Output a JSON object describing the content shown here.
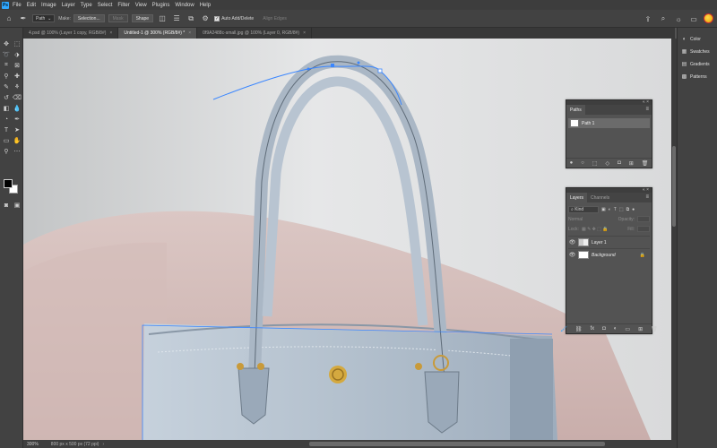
{
  "menu": [
    "File",
    "Edit",
    "Image",
    "Layer",
    "Type",
    "Select",
    "Filter",
    "View",
    "Plugins",
    "Window",
    "Help"
  ],
  "app_logo": "Ps",
  "options": {
    "tool_mode": "Path",
    "make_label": "Make:",
    "selection_btn": "Selection...",
    "mask_btn": "Mask",
    "shape_btn": "Shape",
    "auto_add_delete": "Auto Add/Delete",
    "align_edges": "Align Edges"
  },
  "tabs": [
    {
      "label": "4.psd @ 100% (Layer 1 copy, RGB/8#)",
      "close": "×"
    },
    {
      "label": "Untitled-1 @ 300% (RGB/8#) *",
      "close": "×"
    },
    {
      "label": "0f9A2488c-small.jpg @ 100% (Layer 0, RGB/8#)",
      "close": "×"
    }
  ],
  "status": {
    "zoom": "300%",
    "doc_size": "800 px x 500 px (72 ppi)",
    "arrow": "›"
  },
  "dock": [
    {
      "label": "Color",
      "icon": "color-wheel-icon",
      "glyph": "◐"
    },
    {
      "label": "Swatches",
      "icon": "swatches-icon",
      "glyph": "▦"
    },
    {
      "label": "Gradients",
      "icon": "gradients-icon",
      "glyph": "▤"
    },
    {
      "label": "Patterns",
      "icon": "patterns-icon",
      "glyph": "▩"
    }
  ],
  "paths_panel": {
    "tab": "Paths",
    "items": [
      {
        "name": "Path 1"
      }
    ],
    "collapse": "«",
    "close": "×",
    "menu": "≡"
  },
  "layers_panel": {
    "tabs": [
      "Layers",
      "Channels"
    ],
    "kind": "Kind",
    "blend": "Normal",
    "opacity_label": "Opacity:",
    "lock_label": "Lock:",
    "fill_label": "Fill:",
    "layers": [
      {
        "name": "Layer 1"
      },
      {
        "name": "Background",
        "lock": "🔒"
      }
    ],
    "collapse": "«",
    "close": "×",
    "menu": "≡"
  },
  "colors": {
    "accent": "#31a8ff",
    "path_stroke": "#3a86ff",
    "bag": "#a9b8c8"
  }
}
